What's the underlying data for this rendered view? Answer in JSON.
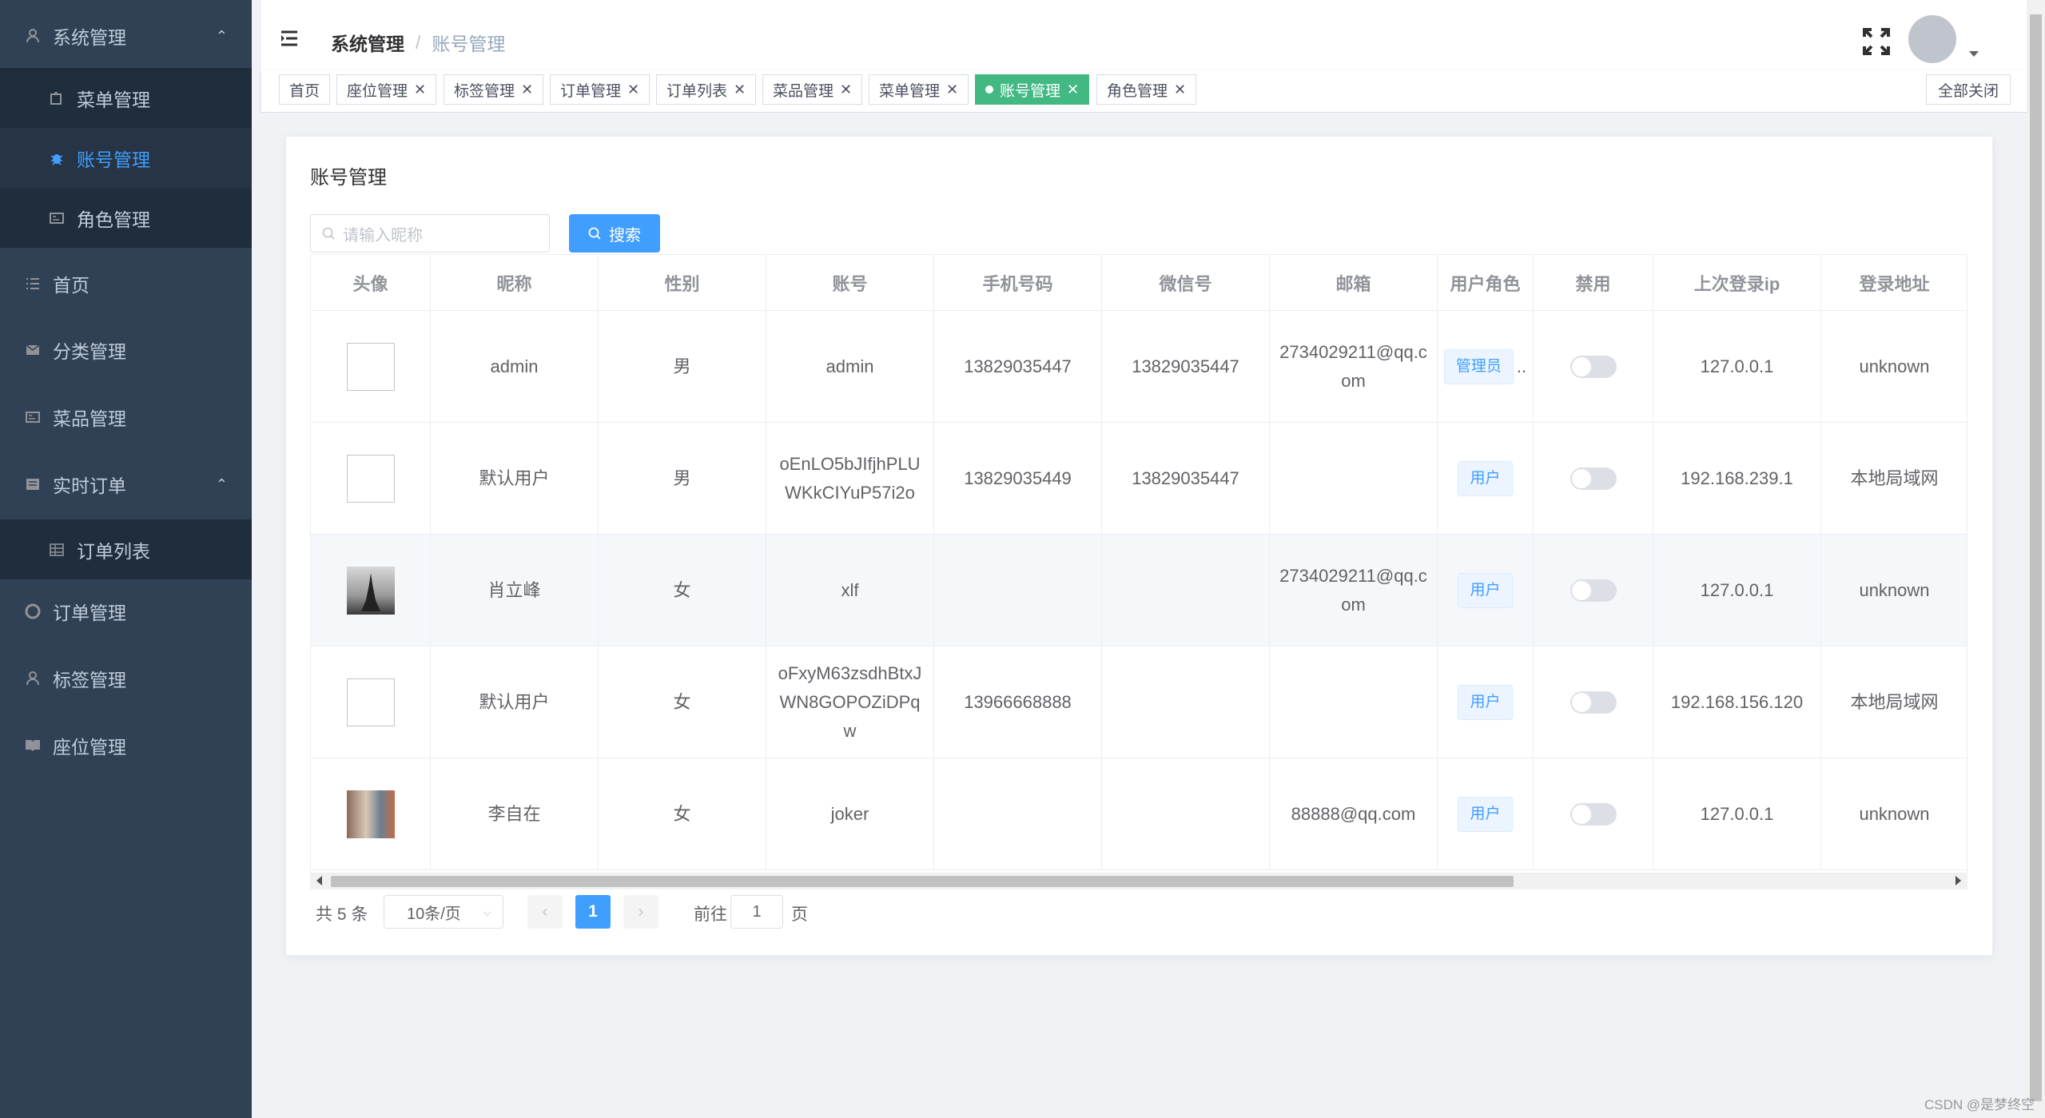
{
  "sidebar": {
    "items": [
      {
        "label": "系统管理",
        "icon": "user-icon"
      },
      {
        "label": "菜单管理",
        "icon": "puzzle-icon"
      },
      {
        "label": "账号管理",
        "icon": "bug-icon"
      },
      {
        "label": "角色管理",
        "icon": "id-card-icon"
      },
      {
        "label": "首页",
        "icon": "list-icon"
      },
      {
        "label": "分类管理",
        "icon": "mail-icon"
      },
      {
        "label": "菜品管理",
        "icon": "id-card-icon"
      },
      {
        "label": "实时订单",
        "icon": "inbox-icon"
      },
      {
        "label": "订单列表",
        "icon": "table-icon"
      },
      {
        "label": "订单管理",
        "icon": "lifebuoy-icon"
      },
      {
        "label": "标签管理",
        "icon": "user-icon"
      },
      {
        "label": "座位管理",
        "icon": "book-icon"
      }
    ]
  },
  "breadcrumb": {
    "level1": "系统管理",
    "sep": "/",
    "level2": "账号管理"
  },
  "tags": [
    "首页",
    "座位管理",
    "标签管理",
    "订单管理",
    "订单列表",
    "菜品管理",
    "菜单管理",
    "账号管理",
    "角色管理"
  ],
  "close_all": "全部关闭",
  "page": {
    "title": "账号管理",
    "search_placeholder": "请输入昵称",
    "search_button": "搜索"
  },
  "table": {
    "headers": [
      "头像",
      "昵称",
      "性别",
      "账号",
      "手机号码",
      "微信号",
      "邮箱",
      "用户角色",
      "禁用",
      "上次登录ip",
      "登录地址"
    ],
    "rows": [
      {
        "nickname": "admin",
        "gender": "男",
        "account": "admin",
        "phone": "13829035447",
        "wechat": "13829035447",
        "email": "2734029211@qq.com",
        "role": "管理员",
        "role_more": "..",
        "ip": "127.0.0.1",
        "location": "unknown"
      },
      {
        "nickname": "默认用户",
        "gender": "男",
        "account": "oEnLO5bJIfjhPLUWKkCIYuP57i2o",
        "phone": "13829035449",
        "wechat": "13829035447",
        "email": "",
        "role": "用户",
        "role_more": "",
        "ip": "192.168.239.1",
        "location": "本地局域网"
      },
      {
        "nickname": "肖立峰",
        "gender": "女",
        "account": "xlf",
        "phone": "",
        "wechat": "",
        "email": "2734029211@qq.com",
        "role": "用户",
        "role_more": "",
        "ip": "127.0.0.1",
        "location": "unknown"
      },
      {
        "nickname": "默认用户",
        "gender": "女",
        "account": "oFxyM63zsdhBtxJWN8GOPOZiDPqw",
        "phone": "13966668888",
        "wechat": "",
        "email": "",
        "role": "用户",
        "role_more": "",
        "ip": "192.168.156.120",
        "location": "本地局域网"
      },
      {
        "nickname": "李自在",
        "gender": "女",
        "account": "joker",
        "phone": "",
        "wechat": "",
        "email": "88888@qq.com",
        "role": "用户",
        "role_more": "",
        "ip": "127.0.0.1",
        "location": "unknown"
      }
    ]
  },
  "pagination": {
    "total": "共 5 条",
    "page_size": "10条/页",
    "prev": "‹",
    "next": "›",
    "current": "1",
    "goto_label": "前往",
    "goto_value": "1",
    "page_suffix": "页"
  },
  "watermark": "CSDN @是梦终空"
}
